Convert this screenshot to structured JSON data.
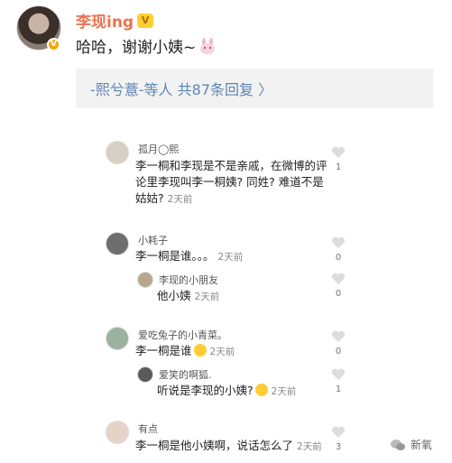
{
  "post": {
    "username": "李现ing",
    "vip_badge": "V",
    "verified_mark": "V",
    "text": "哈哈，谢谢小姨~"
  },
  "reply_summary": "-熙兮薏-等人 共87条回复 〉",
  "comments": [
    {
      "name": "孤月◯熙",
      "text_line1": "李一桐和李现是不是亲戚，在微博的评",
      "text_line2": "论里李现叫李一桐姨? 同姓? 难道不是",
      "text_line3": "姑姑?",
      "time": "2天前",
      "likes": "1"
    },
    {
      "name": "小耗子",
      "text": "李一桐是谁。。。",
      "time": "2天前",
      "likes": "0"
    },
    {
      "name": "李现的小朋友",
      "text": "他小姨",
      "time": "2天前",
      "likes": "0"
    },
    {
      "name": "爱吃兔子的小青菜。",
      "text": "李一桐是谁",
      "time": "2天前",
      "likes": "0"
    },
    {
      "name": "爱笑的啊狐.",
      "text": "听说是李现的小姨?",
      "time": "2天前",
      "likes": "1"
    },
    {
      "name": "有点",
      "text": "李一桐是他小姨啊，说话怎么了",
      "time": "2天前",
      "likes": "3"
    }
  ],
  "watermark": "新氧"
}
